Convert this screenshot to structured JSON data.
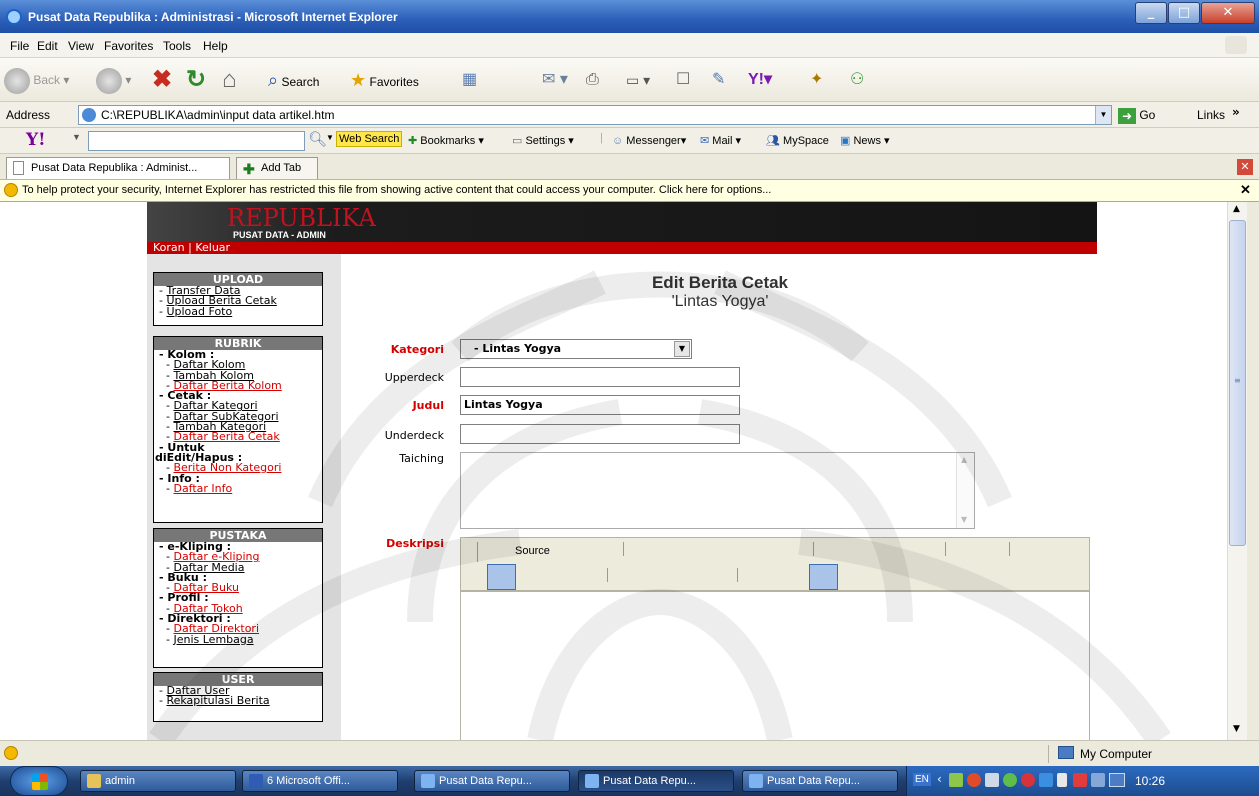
{
  "window": {
    "title": "Pusat Data Republika : Administrasi - Microsoft Internet Explorer"
  },
  "menu": [
    "File",
    "Edit",
    "View",
    "Favorites",
    "Tools",
    "Help"
  ],
  "toolbar": {
    "back": "Back",
    "search": "Search",
    "favorites": "Favorites"
  },
  "address": {
    "label": "Address",
    "url": "C:\\REPUBLIKA\\admin\\input data artikel.htm",
    "go": "Go",
    "links": "Links"
  },
  "yahoo": {
    "logo": "Y!",
    "web_search": "Web Search",
    "bookmarks": "Bookmarks",
    "settings": "Settings",
    "messenger": "Messenger",
    "mail": "Mail",
    "myspace": "MySpace",
    "news": "News"
  },
  "tabs": {
    "current": "Pusat Data Republika : Administ...",
    "add": "Add Tab"
  },
  "infobar": {
    "text": "To help protect your security, Internet Explorer has restricted this file from showing active content that could access your computer. Click here for options..."
  },
  "site": {
    "logo": "REPUBLIKA",
    "subtitle": "PUSAT DATA - ADMIN",
    "topnav": "Koran | Keluar"
  },
  "sidebar": {
    "upload": {
      "header": "UPLOAD",
      "items": [
        "Transfer Data",
        "Upload Berita Cetak",
        "Upload Foto"
      ]
    },
    "rubrik": {
      "header": "RUBRIK",
      "kolom": "Kolom :",
      "kolom_items": [
        "Daftar Kolom",
        "Tambah Kolom",
        "Daftar Berita Kolom"
      ],
      "cetak": "Cetak :",
      "cetak_items": [
        "Daftar Kategori",
        "Daftar SubKategori",
        "Tambah Kategori",
        "Daftar Berita Cetak"
      ],
      "untuk": "Untuk",
      "diedit": "diEdit/Hapus :",
      "diedit_items": [
        "Berita Non Kategori"
      ],
      "info": "Info :",
      "info_items": [
        "Daftar Info"
      ]
    },
    "pustaka": {
      "header": "PUSTAKA",
      "ekliping": "e-Kliping :",
      "ekliping_items": [
        "Daftar e-Kliping",
        "Daftar Media"
      ],
      "buku": "Buku :",
      "buku_items": [
        "Daftar Buku"
      ],
      "profil": "Profil :",
      "profil_items": [
        "Daftar Tokoh"
      ],
      "direktori": "Direktori :",
      "direktori_items": [
        "Daftar Direktori",
        "Jenis Lembaga"
      ]
    },
    "user": {
      "header": "USER",
      "items": [
        "Daftar User",
        "Rekapitulasi Berita"
      ]
    }
  },
  "form": {
    "title": "Edit Berita Cetak",
    "subtitle": "'Lintas Yogya'",
    "kategori_label": "Kategori",
    "kategori_value": "- Lintas Yogya",
    "upperdeck_label": "Upperdeck",
    "upperdeck_value": "",
    "judul_label": "Judul",
    "judul_value": "Lintas Yogya",
    "underdeck_label": "Underdeck",
    "underdeck_value": "",
    "taiching_label": "Taiching",
    "taiching_value": "",
    "deskripsi_label": "Deskripsi",
    "editor_source": "Source"
  },
  "status": {
    "zone": "My Computer"
  },
  "taskbar": {
    "tasks": [
      "admin",
      "6 Microsoft Offi...",
      "Pusat Data Repu...",
      "Pusat Data Repu...",
      "Pusat Data Repu..."
    ],
    "lang": "EN",
    "clock": "10:26"
  }
}
